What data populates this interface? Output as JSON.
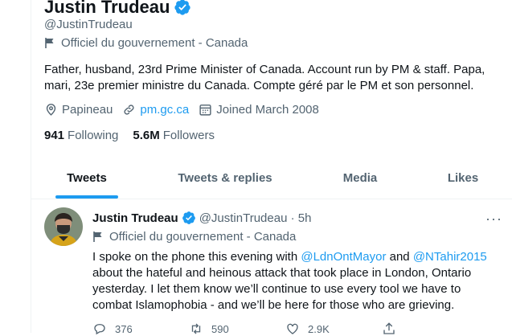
{
  "profile": {
    "name": "Justin Trudeau",
    "handle": "@JustinTrudeau",
    "label": "Officiel du gouvernement - Canada",
    "bio": "Father, husband, 23rd Prime Minister of Canada. Account run by PM & staff. Papa, mari, 23e premier ministre du Canada. Compte géré par le PM et son personnel.",
    "location": "Papineau",
    "website": "pm.gc.ca",
    "joined": "Joined March 2008",
    "following_count": "941",
    "following_label": "Following",
    "followers_count": "5.6M",
    "followers_label": "Followers"
  },
  "tabs": [
    {
      "label": "Tweets",
      "active": true
    },
    {
      "label": "Tweets & replies",
      "active": false
    },
    {
      "label": "Media",
      "active": false
    },
    {
      "label": "Likes",
      "active": false
    }
  ],
  "tweet": {
    "name": "Justin Trudeau",
    "handle_time": "@JustinTrudeau · 5h",
    "label": "Officiel du gouvernement - Canada",
    "text_1": "I spoke on the phone this evening with ",
    "mention_1": "@LdnOntMayor",
    "text_2": " and ",
    "mention_2": "@NTahir2015",
    "text_3": " about the hateful and heinous attack that took place in London, Ontario yesterday. I let them know we’ll continue to use every tool we have to combat Islamophobia - and we’ll be here for those who are grieving.",
    "replies": "376",
    "retweets": "590",
    "likes": "2.9K",
    "more": "···"
  },
  "colors": {
    "accent": "#1d9bf0",
    "secondary_text": "#536471",
    "text": "#0f1419"
  },
  "icons": [
    "verified-badge-icon",
    "government-flag-icon",
    "location-icon",
    "link-icon",
    "calendar-icon",
    "reply-icon",
    "retweet-icon",
    "like-icon",
    "share-icon",
    "more-icon"
  ]
}
